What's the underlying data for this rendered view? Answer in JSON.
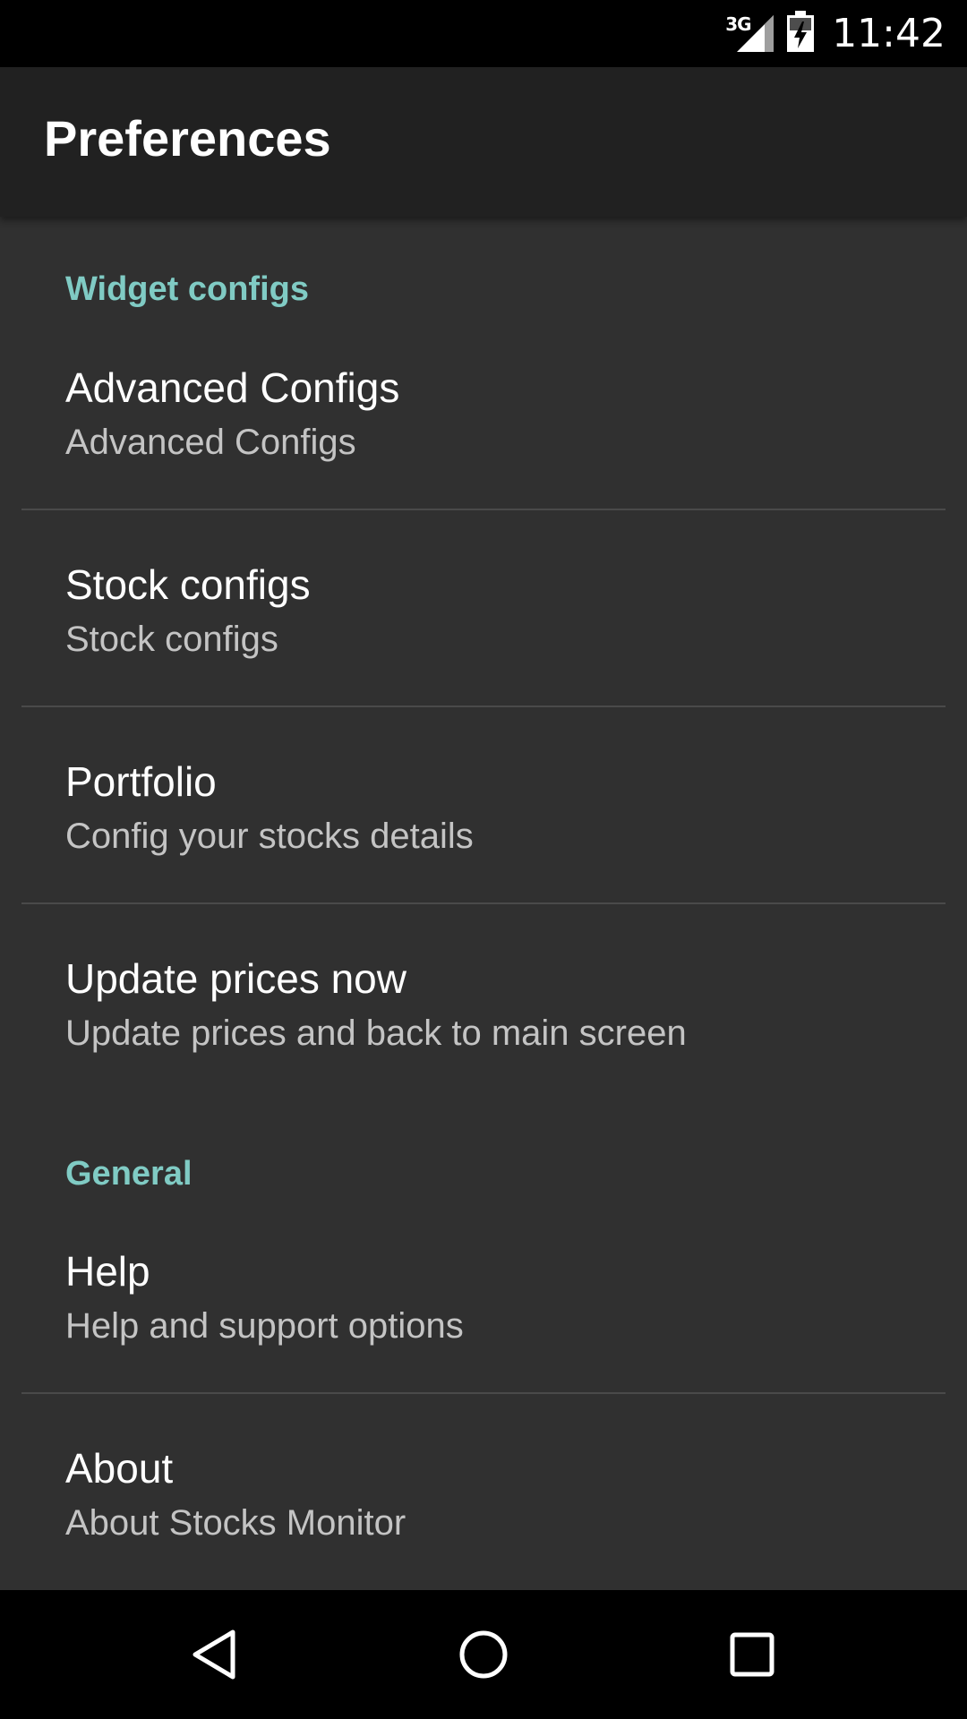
{
  "status_bar": {
    "network_label": "3G",
    "time": "11:42"
  },
  "app_bar": {
    "title": "Preferences"
  },
  "categories": {
    "widget": "Widget configs",
    "general": "General"
  },
  "preferences": [
    {
      "title": "Advanced Configs",
      "summary": "Advanced Configs"
    },
    {
      "title": "Stock configs",
      "summary": "Stock configs"
    },
    {
      "title": "Portfolio",
      "summary": "Config your stocks details"
    },
    {
      "title": "Update prices now",
      "summary": "Update prices and back to main screen"
    },
    {
      "title": "Help",
      "summary": "Help and support options"
    },
    {
      "title": "About",
      "summary": "About Stocks Monitor"
    }
  ],
  "nav_bar": {
    "back_icon": "back-triangle-icon",
    "home_icon": "home-circle-icon",
    "recents_icon": "recents-square-icon"
  },
  "colors": {
    "accent": "#80cbc4",
    "background": "#303030",
    "app_bar": "#212121"
  }
}
